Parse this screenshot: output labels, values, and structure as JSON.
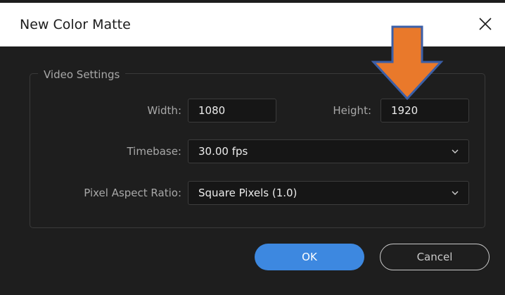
{
  "dialog": {
    "title": "New Color Matte",
    "close_icon": "close-icon"
  },
  "video_settings": {
    "legend": "Video Settings",
    "width_label": "Width:",
    "width_value": "1080",
    "height_label": "Height:",
    "height_value": "1920",
    "timebase_label": "Timebase:",
    "timebase_value": "30.00 fps",
    "par_label": "Pixel Aspect Ratio:",
    "par_value": "Square Pixels (1.0)"
  },
  "buttons": {
    "ok_label": "OK",
    "cancel_label": "Cancel"
  },
  "colors": {
    "accent": "#3d88e0",
    "annotation_arrow": "#e9792b",
    "dialog_bg": "#1e1e1e"
  },
  "icons": {
    "chevron": "chevron-down-icon",
    "annotation": "arrow-down-icon"
  }
}
